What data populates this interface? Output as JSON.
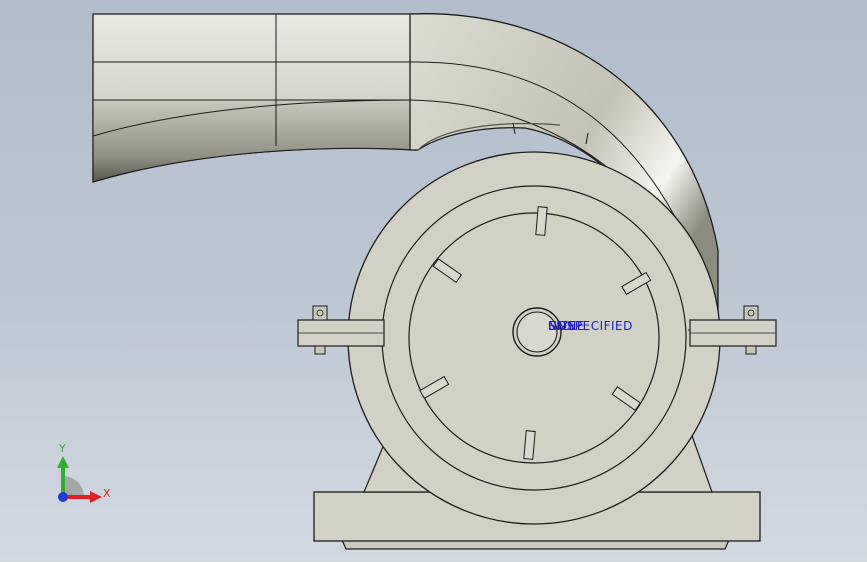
{
  "viewport": {
    "background_top": "#b2bdcc",
    "background_bottom": "#d3d9e1"
  },
  "model": {
    "fill": "#d1d1c6",
    "edge": "#1c1c1c"
  },
  "annotations": {
    "overlap_texts": [
      "SIZE",
      "NONE",
      "UNSPECIFIED"
    ],
    "color": "#1a1ad8"
  },
  "triad": {
    "y_label": "Y",
    "x_label": "X",
    "y_color": "#2fae2f",
    "x_color": "#e32020",
    "z_color": "#1f3bd8"
  }
}
